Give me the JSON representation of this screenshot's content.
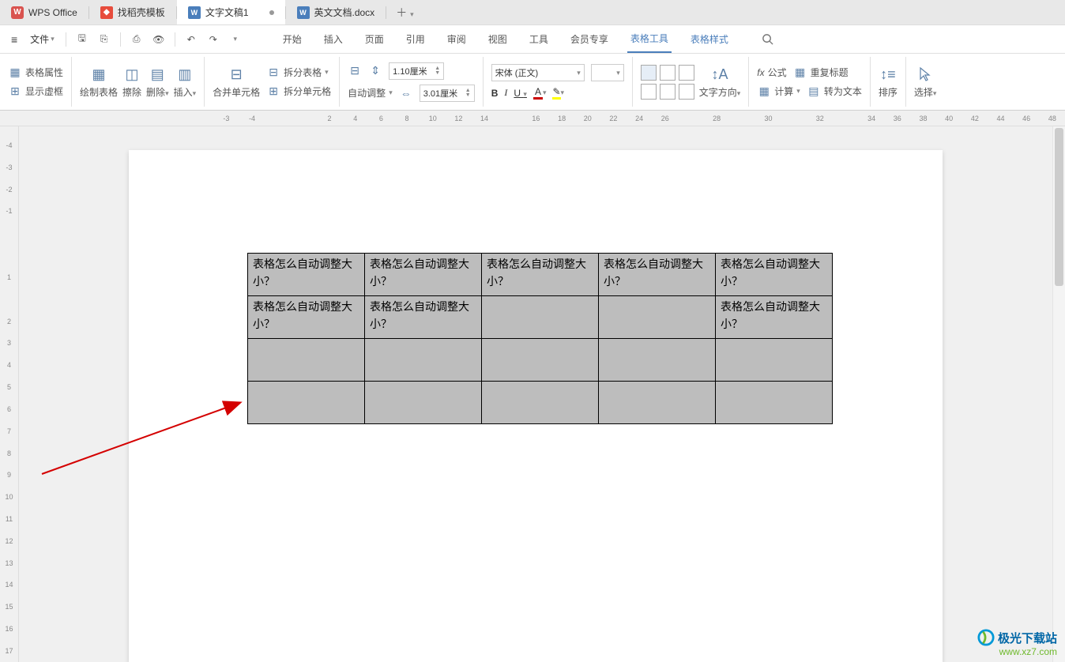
{
  "tabs": {
    "app": "WPS Office",
    "template": "找稻壳模板",
    "doc1": "文字文稿1",
    "doc2": "英文文档.docx"
  },
  "menu": {
    "file": "文件",
    "items": [
      "开始",
      "插入",
      "页面",
      "引用",
      "审阅",
      "视图",
      "工具",
      "会员专享",
      "表格工具",
      "表格样式"
    ]
  },
  "ribbon": {
    "table_props": "表格属性",
    "show_gridlines": "显示虚框",
    "draw_table": "绘制表格",
    "eraser": "擦除",
    "delete": "删除",
    "insert": "插入",
    "merge_cells": "合并单元格",
    "split_table": "拆分表格",
    "split_cells": "拆分单元格",
    "auto_adjust": "自动调整",
    "height": "1.10厘米",
    "width": "3.01厘米",
    "font_name": "宋体 (正文)",
    "font_size": "",
    "bold": "B",
    "italic": "I",
    "underline": "U",
    "text_direction": "文字方向",
    "fx": "fx",
    "formula": "公式",
    "repeat_header": "重复标题",
    "calc": "计算",
    "to_text": "转为文本",
    "sort": "排序",
    "select": "选择"
  },
  "ruler_h": [
    "-3",
    "-4",
    "",
    "",
    "2",
    "4",
    "6",
    "8",
    "10",
    "12",
    "14",
    "",
    "16",
    "18",
    "20",
    "22",
    "24",
    "26",
    "",
    "28",
    "",
    "30",
    "",
    "32",
    "",
    "34",
    "36",
    "38",
    "40",
    "42",
    "44",
    "46",
    "48"
  ],
  "ruler_v": [
    "-4",
    "-3",
    "-2",
    "-1",
    "",
    "",
    "1",
    "",
    "2",
    "3",
    "4",
    "5",
    "6",
    "7",
    "8",
    "9",
    "10",
    "11",
    "12",
    "13",
    "14",
    "15",
    "16",
    "17"
  ],
  "table": {
    "cell_text": "表格怎么自动调整大小？",
    "rows": [
      [
        true,
        true,
        true,
        true,
        true
      ],
      [
        true,
        true,
        false,
        false,
        true
      ],
      [
        false,
        false,
        false,
        false,
        false
      ],
      [
        false,
        false,
        false,
        false,
        false
      ]
    ]
  },
  "watermark": {
    "line1": "极光下载站",
    "line2": "www.xz7.com"
  }
}
